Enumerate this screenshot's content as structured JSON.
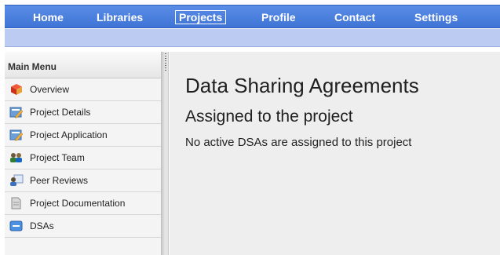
{
  "nav": {
    "items": [
      {
        "label": "Home"
      },
      {
        "label": "Libraries"
      },
      {
        "label": "Projects",
        "active": true
      },
      {
        "label": "Profile"
      },
      {
        "label": "Contact"
      },
      {
        "label": "Settings"
      }
    ],
    "active_color": "#ffffff",
    "bar_color": "#4a7fdc"
  },
  "sidebar": {
    "header": "Main Menu",
    "items": [
      {
        "label": "Overview",
        "icon": "cube-icon"
      },
      {
        "label": "Project Details",
        "icon": "edit-document-icon"
      },
      {
        "label": "Project Application",
        "icon": "edit-document-icon"
      },
      {
        "label": "Project Team",
        "icon": "team-icon"
      },
      {
        "label": "Peer Reviews",
        "icon": "review-icon"
      },
      {
        "label": "Project Documentation",
        "icon": "document-icon"
      },
      {
        "label": "DSAs",
        "icon": "dsa-icon"
      }
    ]
  },
  "main": {
    "title": "Data Sharing Agreements",
    "subtitle": "Assigned to the project",
    "message": "No active DSAs are assigned to this project"
  }
}
